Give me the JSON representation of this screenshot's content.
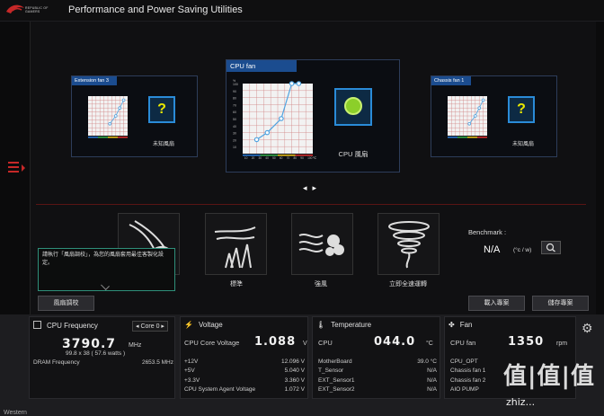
{
  "window": {
    "title": "Performance and Power Saving Utilities",
    "logo_line1": "REPUBLIC OF",
    "logo_line2": "GAMERS"
  },
  "fan_cards": [
    {
      "name": "Extension fan 3",
      "case_label": "未知風扇",
      "case_icon": "question-mark",
      "curve": [
        [
          55,
          30
        ],
        [
          70,
          50
        ],
        [
          80,
          70
        ],
        [
          90,
          90
        ]
      ]
    },
    {
      "name": "CPU fan",
      "case_label": "CPU 風扇",
      "case_icon": "cpu-fan",
      "curve": [
        [
          20,
          20
        ],
        [
          35,
          30
        ],
        [
          55,
          50
        ],
        [
          70,
          100
        ],
        [
          80,
          100
        ]
      ]
    },
    {
      "name": "Chassis fan 1",
      "case_label": "未知風扇",
      "case_icon": "question-mark",
      "curve": [
        [
          55,
          30
        ],
        [
          70,
          50
        ],
        [
          80,
          70
        ],
        [
          90,
          90
        ]
      ]
    }
  ],
  "chart_axis": {
    "y_ticks": [
      "%",
      "100",
      "90",
      "80",
      "70",
      "60",
      "50",
      "40",
      "30",
      "20",
      "10"
    ],
    "x_ticks": [
      "10",
      "20",
      "30",
      "40",
      "50",
      "60",
      "70",
      "80",
      "90",
      "100"
    ],
    "x_unit": "℃"
  },
  "fan_modes": [
    {
      "label": "",
      "icon": "silent-mode-icon"
    },
    {
      "label": "標準",
      "icon": "standard-mode-icon"
    },
    {
      "label": "強風",
      "icon": "turbo-mode-icon"
    },
    {
      "label": "立即全速運轉",
      "icon": "full-speed-icon"
    }
  ],
  "tooltip": "請執行「風扇調校」，為您的風扇套用最佳客製化設定。",
  "benchmark": {
    "label": "Benchmark :",
    "value": "N/A",
    "unit": "(°c / w)"
  },
  "buttons": {
    "fan_tuning": "風扇調校",
    "load_profile": "載入專案",
    "save_profile": "儲存專案"
  },
  "cpu_freq": {
    "title": "CPU Frequency",
    "core_select": "Core 0",
    "value": "3790.7",
    "unit": "MHz",
    "detail": "99.8  x  38   ( 57.6 watts )",
    "dram_label": "DRAM Frequency",
    "dram_value": "2653.5  MHz"
  },
  "voltage": {
    "title": "Voltage",
    "main_label": "CPU Core Voltage",
    "main_value": "1.088",
    "main_unit": "V",
    "rows": [
      {
        "label": "+12V",
        "value": "12.096  V"
      },
      {
        "label": "+5V",
        "value": "5.040  V"
      },
      {
        "label": "+3.3V",
        "value": "3.360  V"
      },
      {
        "label": "CPU System Agent Voltage",
        "value": "1.072  V"
      }
    ]
  },
  "temperature": {
    "title": "Temperature",
    "main_label": "CPU",
    "main_value": "044.0",
    "main_unit": "°C",
    "rows": [
      {
        "label": "MotherBoard",
        "value": "39.0 °C"
      },
      {
        "label": "T_Sensor",
        "value": "N/A"
      },
      {
        "label": "EXT_Sensor1",
        "value": "N/A"
      },
      {
        "label": "EXT_Sensor2",
        "value": "N/A"
      }
    ]
  },
  "fan": {
    "title": "Fan",
    "main_label": "CPU fan",
    "main_value": "1350",
    "main_unit": "rpm",
    "rows": [
      {
        "label": "CPU_OPT"
      },
      {
        "label": "Chassis fan 1"
      },
      {
        "label": "Chassis fan 2"
      },
      {
        "label": "AIO PUMP"
      }
    ]
  },
  "footer": "Western",
  "watermark": {
    "text": "值|值|值",
    "url": "zhiz..."
  },
  "colors": {
    "accent_red": "#c62828",
    "header_blue": "#1b4c8f",
    "curve": "#4fa3e0",
    "curve_green": "#7bbf3a"
  }
}
